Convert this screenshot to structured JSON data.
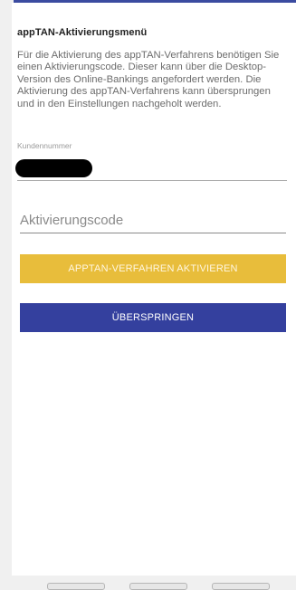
{
  "header": {
    "title": "appTAN-Aktivierungsmenü"
  },
  "intro": {
    "text": "Für die Aktivierung des appTAN-Verfahrens benötigen Sie einen Aktivierungscode. Dieser kann über die Desktop-Version des Online-Bankings angefordert werden. Die Aktivierung des appTAN-Verfahrens kann übersprungen und in den Einstellungen nachgeholt werden."
  },
  "customer_field": {
    "label": "Kundennummer",
    "value": ""
  },
  "activation_field": {
    "placeholder": "Aktivierungscode",
    "value": ""
  },
  "buttons": {
    "activate_label": "APPTAN-VERFAHREN AKTIVIEREN",
    "skip_label": "ÜBERSPRINGEN"
  },
  "colors": {
    "accent_blue": "#34409e",
    "accent_yellow": "#e8bd3b"
  }
}
